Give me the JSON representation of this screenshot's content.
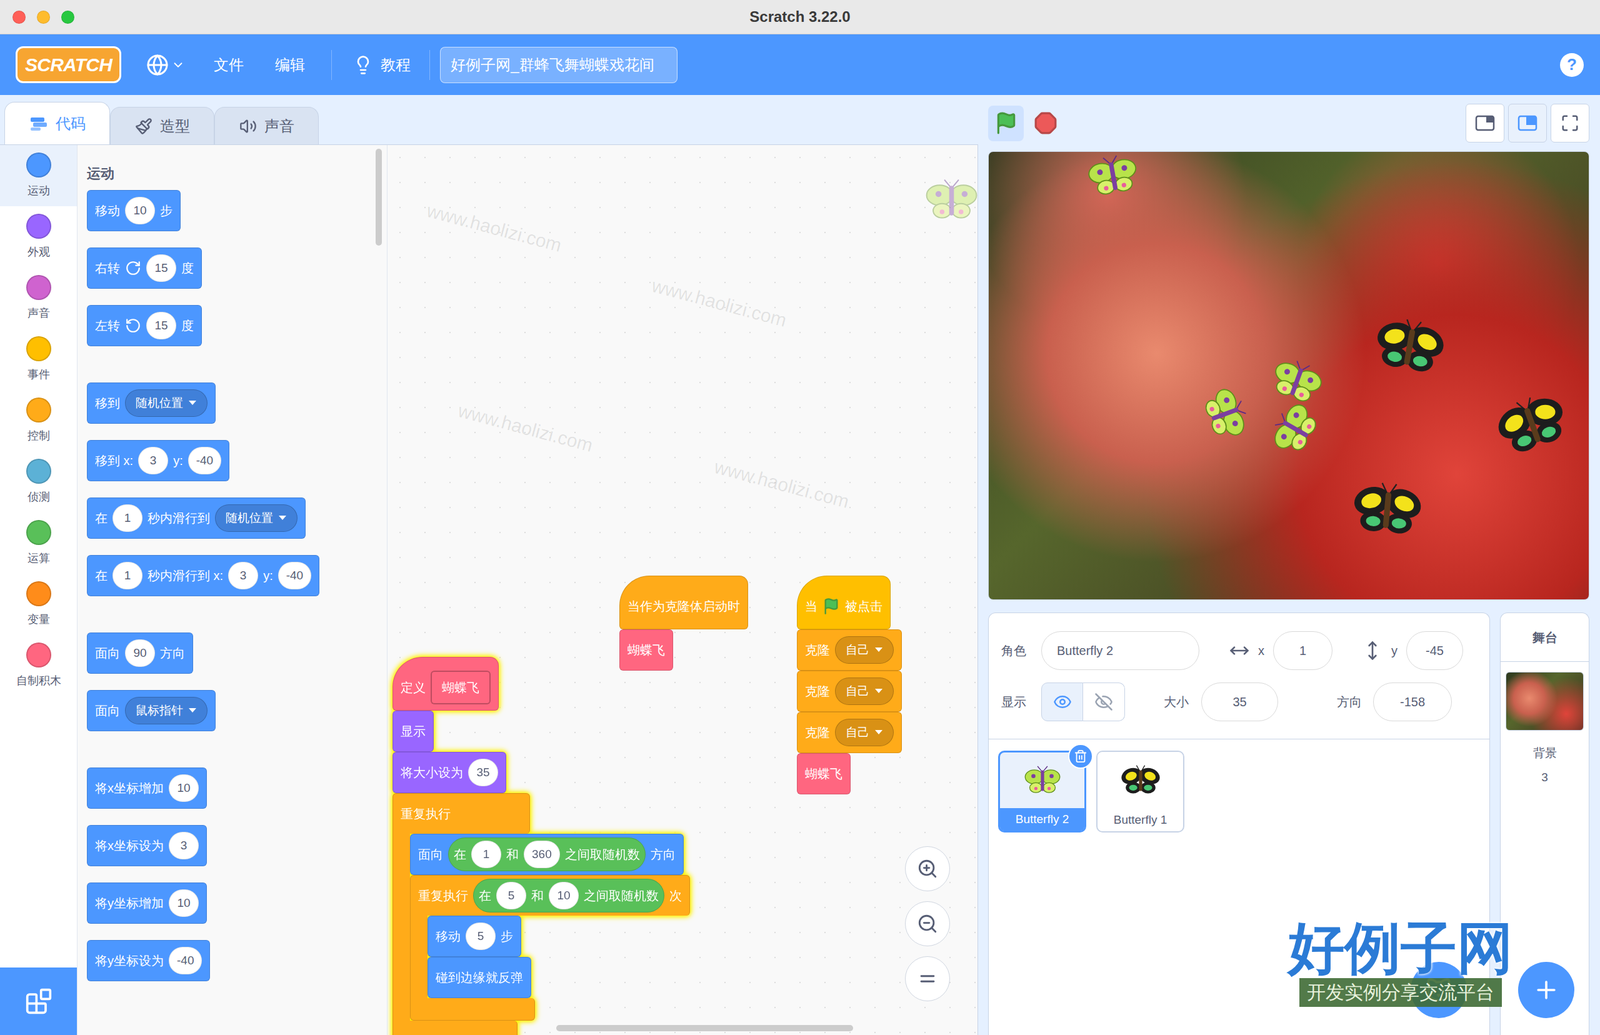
{
  "window": {
    "title": "Scratch 3.22.0",
    "traffic_lights": [
      {
        "color": "#FF5F57"
      },
      {
        "color": "#FEBC2E"
      },
      {
        "color": "#28C840"
      }
    ]
  },
  "menu_bar": {
    "logo": "SCRATCH",
    "items": [
      "文件",
      "编辑",
      "教程"
    ],
    "project_title": "好例子网_群蜂飞舞蝴蝶戏花间",
    "help": "?"
  },
  "tabs": [
    {
      "label": "代码",
      "selected": true,
      "kind": "code"
    },
    {
      "label": "造型",
      "selected": false,
      "kind": "costume"
    },
    {
      "label": "声音",
      "selected": false,
      "kind": "sound"
    }
  ],
  "categories": [
    {
      "label": "运动",
      "color": "#4C97FF",
      "selected": true
    },
    {
      "label": "外观",
      "color": "#9966FF",
      "selected": false
    },
    {
      "label": "声音",
      "color": "#CF63CF",
      "selected": false
    },
    {
      "label": "事件",
      "color": "#FFBF00",
      "selected": false
    },
    {
      "label": "控制",
      "color": "#FFAB19",
      "selected": false
    },
    {
      "label": "侦测",
      "color": "#5CB1D6",
      "selected": false
    },
    {
      "label": "运算",
      "color": "#59C059",
      "selected": false
    },
    {
      "label": "变量",
      "color": "#FF8C1A",
      "selected": false
    },
    {
      "label": "自制积木",
      "color": "#FF6680",
      "selected": false
    }
  ],
  "palette": {
    "heading": "运动",
    "groups": [
      [
        {
          "category": "运动",
          "parts": [
            {
              "kind": "text",
              "text": "移动"
            },
            {
              "kind": "input",
              "text": "10"
            },
            {
              "kind": "text",
              "text": "步"
            }
          ]
        },
        {
          "category": "运动",
          "parts": [
            {
              "kind": "text",
              "text": "右转"
            },
            {
              "kind": "cw"
            },
            {
              "kind": "input",
              "text": "15"
            },
            {
              "kind": "text",
              "text": "度"
            }
          ]
        },
        {
          "category": "运动",
          "parts": [
            {
              "kind": "text",
              "text": "左转"
            },
            {
              "kind": "ccw"
            },
            {
              "kind": "input",
              "text": "15"
            },
            {
              "kind": "text",
              "text": "度"
            }
          ]
        }
      ],
      [
        {
          "category": "运动",
          "parts": [
            {
              "kind": "text",
              "text": "移到"
            },
            {
              "kind": "dropdown",
              "text": "随机位置"
            }
          ]
        },
        {
          "category": "运动",
          "parts": [
            {
              "kind": "text",
              "text": "移到 x:"
            },
            {
              "kind": "input",
              "text": "3"
            },
            {
              "kind": "text",
              "text": "y:"
            },
            {
              "kind": "input",
              "text": "-40"
            }
          ]
        },
        {
          "category": "运动",
          "parts": [
            {
              "kind": "text",
              "text": "在"
            },
            {
              "kind": "input",
              "text": "1"
            },
            {
              "kind": "text",
              "text": "秒内滑行到"
            },
            {
              "kind": "dropdown",
              "text": "随机位置"
            }
          ]
        },
        {
          "category": "运动",
          "parts": [
            {
              "kind": "text",
              "text": "在"
            },
            {
              "kind": "input",
              "text": "1"
            },
            {
              "kind": "text",
              "text": "秒内滑行到 x:"
            },
            {
              "kind": "input",
              "text": "3"
            },
            {
              "kind": "text",
              "text": "y:"
            },
            {
              "kind": "input",
              "text": "-40"
            }
          ]
        }
      ],
      [
        {
          "category": "运动",
          "parts": [
            {
              "kind": "text",
              "text": "面向"
            },
            {
              "kind": "input",
              "text": "90"
            },
            {
              "kind": "text",
              "text": "方向"
            }
          ]
        },
        {
          "category": "运动",
          "parts": [
            {
              "kind": "text",
              "text": "面向"
            },
            {
              "kind": "dropdown",
              "text": "鼠标指针"
            }
          ]
        }
      ],
      [
        {
          "category": "运动",
          "parts": [
            {
              "kind": "text",
              "text": "将x坐标增加"
            },
            {
              "kind": "input",
              "text": "10"
            }
          ]
        },
        {
          "category": "运动",
          "parts": [
            {
              "kind": "text",
              "text": "将x坐标设为"
            },
            {
              "kind": "input",
              "text": "3"
            }
          ]
        },
        {
          "category": "运动",
          "parts": [
            {
              "kind": "text",
              "text": "将y坐标增加"
            },
            {
              "kind": "input",
              "text": "10"
            }
          ]
        },
        {
          "category": "运动",
          "parts": [
            {
              "kind": "text",
              "text": "将y坐标设为"
            },
            {
              "kind": "input",
              "text": "-40"
            }
          ]
        }
      ]
    ]
  },
  "scripts": [
    {
      "glow": false,
      "blocks": [
        {
          "kind": "hat",
          "category": "控制",
          "parts": [
            {
              "kind": "text",
              "text": "当作为克隆体启动时"
            }
          ]
        },
        {
          "kind": "stack",
          "category": "自制积木",
          "parts": [
            {
              "kind": "text",
              "text": "蝴蝶飞"
            }
          ]
        }
      ]
    },
    {
      "glow": false,
      "blocks": [
        {
          "kind": "hat",
          "category": "事件",
          "parts": [
            {
              "kind": "text",
              "text": "当"
            },
            {
              "kind": "flag"
            },
            {
              "kind": "text",
              "text": "被点击"
            }
          ]
        },
        {
          "kind": "stack",
          "category": "控制",
          "parts": [
            {
              "kind": "text",
              "text": "克隆"
            },
            {
              "kind": "dropdown",
              "text": "自己"
            }
          ]
        },
        {
          "kind": "stack",
          "category": "控制",
          "parts": [
            {
              "kind": "text",
              "text": "克隆"
            },
            {
              "kind": "dropdown",
              "text": "自己"
            }
          ]
        },
        {
          "kind": "stack",
          "category": "控制",
          "parts": [
            {
              "kind": "text",
              "text": "克隆"
            },
            {
              "kind": "dropdown",
              "text": "自己"
            }
          ]
        },
        {
          "kind": "stack",
          "category": "自制积木",
          "parts": [
            {
              "kind": "text",
              "text": "蝴蝶飞"
            }
          ]
        }
      ]
    },
    {
      "glow": true,
      "blocks": [
        {
          "kind": "define",
          "category": "自制积木",
          "parts": [
            {
              "kind": "text",
              "text": "定义"
            },
            {
              "kind": "proto",
              "category": "自制积木",
              "text": "蝴蝶飞"
            }
          ]
        },
        {
          "kind": "stack",
          "category": "外观",
          "parts": [
            {
              "kind": "text",
              "text": "显示"
            }
          ]
        },
        {
          "kind": "stack",
          "category": "外观",
          "parts": [
            {
              "kind": "text",
              "text": "将大小设为"
            },
            {
              "kind": "input",
              "text": "35"
            }
          ]
        },
        {
          "kind": "c",
          "category": "控制",
          "parts": [
            {
              "kind": "text",
              "text": "重复执行"
            }
          ],
          "inner": [
            {
              "kind": "stack",
              "category": "运动",
              "parts": [
                {
                  "kind": "text",
                  "text": "面向"
                },
                {
                  "kind": "reporter",
                  "category": "运算",
                  "parts": [
                    {
                      "kind": "text",
                      "text": "在"
                    },
                    {
                      "kind": "input",
                      "text": "1"
                    },
                    {
                      "kind": "text",
                      "text": "和"
                    },
                    {
                      "kind": "input",
                      "text": "360"
                    },
                    {
                      "kind": "text",
                      "text": "之间取随机数"
                    }
                  ]
                },
                {
                  "kind": "text",
                  "text": "方向"
                }
              ]
            },
            {
              "kind": "c",
              "category": "控制",
              "parts": [
                {
                  "kind": "text",
                  "text": "重复执行"
                },
                {
                  "kind": "reporter",
                  "category": "运算",
                  "parts": [
                    {
                      "kind": "text",
                      "text": "在"
                    },
                    {
                      "kind": "input",
                      "text": "5"
                    },
                    {
                      "kind": "text",
                      "text": "和"
                    },
                    {
                      "kind": "input",
                      "text": "10"
                    },
                    {
                      "kind": "text",
                      "text": "之间取随机数"
                    }
                  ]
                },
                {
                  "kind": "text",
                  "text": "次"
                }
              ],
              "inner": [
                {
                  "kind": "stack",
                  "category": "运动",
                  "parts": [
                    {
                      "kind": "text",
                      "text": "移动"
                    },
                    {
                      "kind": "input",
                      "text": "5"
                    },
                    {
                      "kind": "text",
                      "text": "步"
                    }
                  ]
                },
                {
                  "kind": "stack",
                  "category": "运动",
                  "parts": [
                    {
                      "kind": "text",
                      "text": "碰到边缘就反弹"
                    }
                  ]
                }
              ]
            }
          ]
        }
      ]
    }
  ],
  "stage_controls": {
    "flag_running": true,
    "layout_buttons": [
      {
        "kind": "small",
        "selected": false
      },
      {
        "kind": "normal",
        "selected": true
      },
      {
        "kind": "full",
        "selected": false
      }
    ]
  },
  "sprite_info": {
    "sprite_label": "角色",
    "sprite_name": "Butterfly 2",
    "x_label": "x",
    "x": "1",
    "y_label": "y",
    "y": "-45",
    "show_label": "显示",
    "visible": true,
    "size_label": "大小",
    "size": "35",
    "direction_label": "方向",
    "direction": "-158"
  },
  "sprites": [
    {
      "name": "Butterfly 2",
      "selected": true,
      "kind": "b2"
    },
    {
      "name": "Butterfly 1",
      "selected": false,
      "kind": "b1"
    }
  ],
  "stage_selector": {
    "title": "舞台",
    "backdrop_label": "背景",
    "backdrop_count": "3"
  },
  "watermark": {
    "text": "www.haolizi.com",
    "logo": "好例子网",
    "tagline": "开发实例分享交流平台"
  }
}
